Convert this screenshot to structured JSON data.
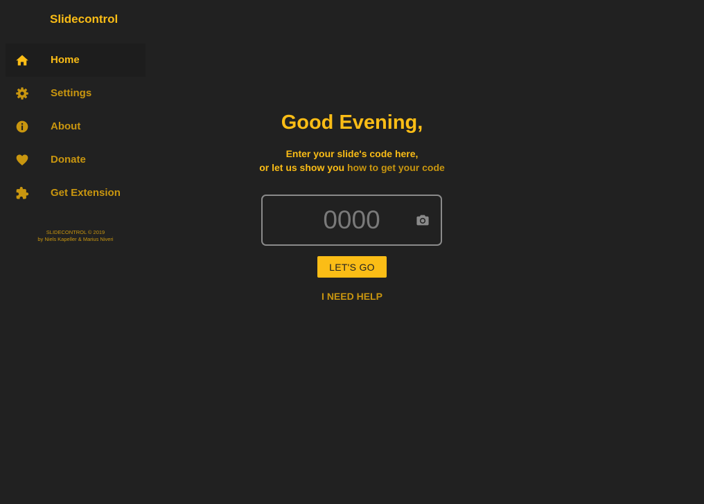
{
  "sidebar": {
    "brand": "Slidecontrol",
    "items": [
      {
        "label": "Home",
        "icon": "home-icon"
      },
      {
        "label": "Settings",
        "icon": "gear-icon"
      },
      {
        "label": "About",
        "icon": "info-icon"
      },
      {
        "label": "Donate",
        "icon": "heart-icon"
      },
      {
        "label": "Get Extension",
        "icon": "puzzle-icon"
      }
    ],
    "active_item": "Home",
    "footer_line1": "SLIDECONTROL © 2019",
    "footer_line2": "by Niels Kapeller & Marius Niveri"
  },
  "main": {
    "greeting": "Good Evening,",
    "subtitle_line1": "Enter your slide's code here,",
    "subtitle_line2_prefix": "or let us show you",
    "subtitle_link": "how to get your code",
    "code_input": {
      "value": "",
      "placeholder": "0000",
      "camera_icon": "camera-icon"
    },
    "go_button_label": "LET'S GO",
    "help_button_label": "I NEED HELP"
  },
  "colors": {
    "background": "#212121",
    "accent": "#fbbd16",
    "accent_dim": "#c9960f",
    "input_border": "#8b8b8b",
    "placeholder": "#7a7a7a"
  }
}
